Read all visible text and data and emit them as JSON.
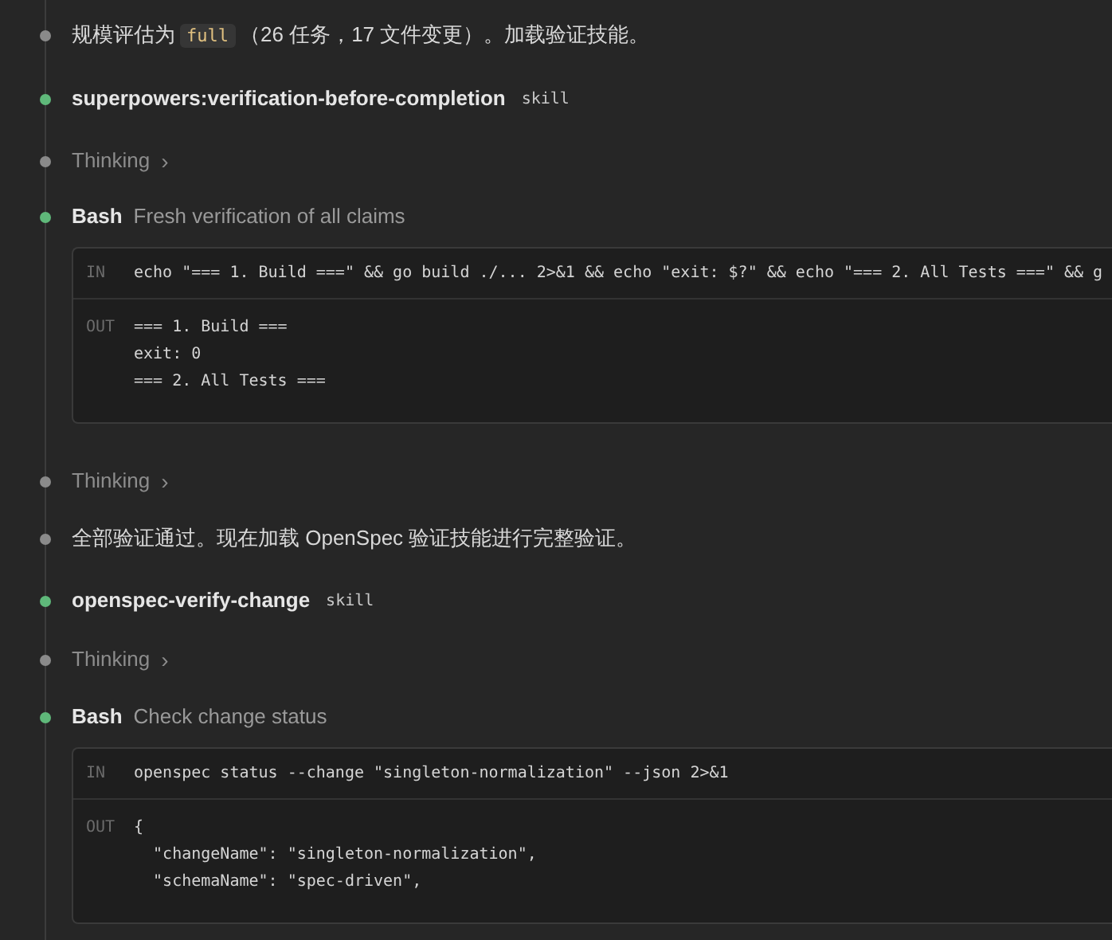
{
  "timeline": [
    {
      "kind": "text",
      "color": "#8a8a8a",
      "parts": [
        {
          "kind": "plain",
          "text": "规模评估为"
        },
        {
          "kind": "code",
          "text": "full"
        },
        {
          "kind": "plain",
          "text": "（26 任务，17 文件变更）。加载验证技能。"
        }
      ]
    },
    {
      "kind": "skill",
      "color": "#5fb87a",
      "name": "superpowers:verification-before-completion",
      "tag": "skill"
    },
    {
      "kind": "thinking",
      "color": "#8a8a8a",
      "label": "Thinking",
      "chevron": "›"
    },
    {
      "kind": "bash",
      "color": "#5fb87a",
      "name": "Bash",
      "description": "Fresh verification of all claims",
      "input_label": "IN",
      "input": "echo \"=== 1. Build ===\" && go build ./... 2>&1 && echo \"exit: $?\" && echo \"=== 2. All Tests ===\" && g",
      "output_label": "OUT",
      "output": [
        "=== 1. Build ===",
        "exit: 0",
        "=== 2. All Tests ==="
      ]
    },
    {
      "kind": "thinking",
      "color": "#8a8a8a",
      "label": "Thinking",
      "chevron": "›"
    },
    {
      "kind": "text",
      "color": "#8a8a8a",
      "parts": [
        {
          "kind": "plain",
          "text": "全部验证通过。现在加载 OpenSpec 验证技能进行完整验证。"
        }
      ]
    },
    {
      "kind": "skill",
      "color": "#5fb87a",
      "name": "openspec-verify-change",
      "tag": "skill"
    },
    {
      "kind": "thinking",
      "color": "#8a8a8a",
      "label": "Thinking",
      "chevron": "›"
    },
    {
      "kind": "bash",
      "color": "#5fb87a",
      "name": "Bash",
      "description": "Check change status",
      "input_label": "IN",
      "input": "openspec status --change \"singleton-normalization\" --json 2>&1",
      "output_label": "OUT",
      "output": [
        "{",
        "  \"changeName\": \"singleton-normalization\",",
        "  \"schemaName\": \"spec-driven\","
      ]
    }
  ]
}
